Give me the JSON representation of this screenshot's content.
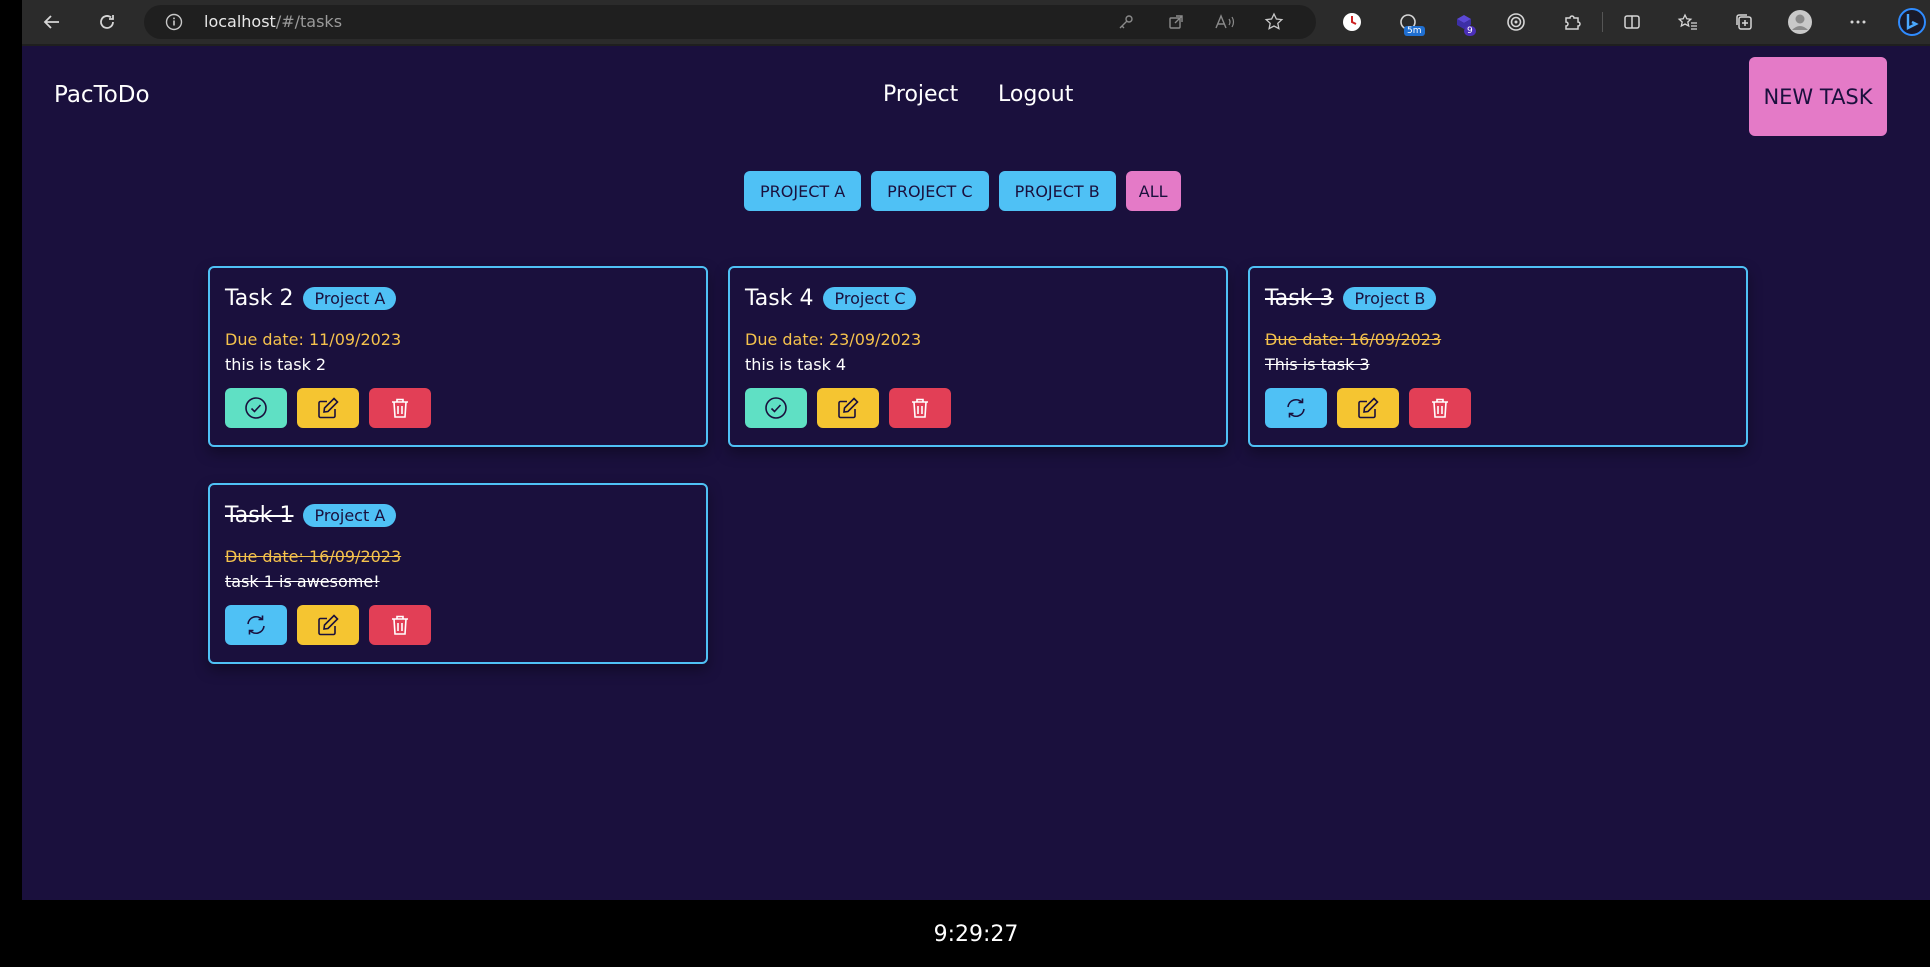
{
  "browser": {
    "url_host": "localhost",
    "url_path": "/#/tasks",
    "ext_badge_1": "5m",
    "ext_badge_2": "9"
  },
  "app": {
    "brand": "PacToDo",
    "nav": {
      "project": "Project",
      "logout": "Logout"
    },
    "new_task_label": "NEW TASK",
    "filters": [
      {
        "label": "PROJECT A"
      },
      {
        "label": "PROJECT C"
      },
      {
        "label": "PROJECT B"
      },
      {
        "label": "ALL"
      }
    ],
    "tasks": [
      {
        "title": "Task 2",
        "project": "Project A",
        "due": "Due date: 11/09/2023",
        "description": "this is task 2",
        "completed": false
      },
      {
        "title": "Task 4",
        "project": "Project C",
        "due": "Due date: 23/09/2023",
        "description": "this is task 4",
        "completed": false
      },
      {
        "title": "Task 3",
        "project": "Project B",
        "due": "Due date: 16/09/2023",
        "description": "This is task 3",
        "completed": true
      },
      {
        "title": "Task 1",
        "project": "Project A",
        "due": "Due date: 16/09/2023",
        "description": "task 1 is awesome!",
        "completed": true
      }
    ],
    "clock": "9:29:27"
  },
  "colors": {
    "background": "#1a103d",
    "accent_blue": "#4fc1f5",
    "accent_pink": "#e47ac7",
    "due_yellow": "#f5c24c",
    "complete_green": "#5fe0c4",
    "edit_yellow": "#f5c531",
    "delete_red": "#e23f56"
  }
}
